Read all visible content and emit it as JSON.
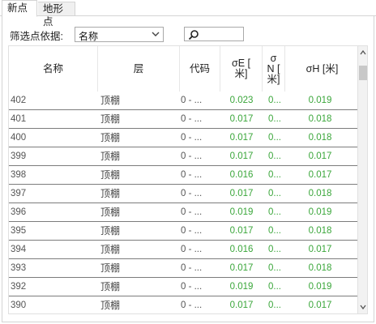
{
  "tabs": {
    "active": "新点",
    "inactive": "地形点"
  },
  "filter": {
    "label": "筛选点依据:",
    "selected": "名称",
    "search_value": ""
  },
  "table": {
    "headers": {
      "name": "名称",
      "layer": "层",
      "code": "代码",
      "sigma_e": "σE [\n米]",
      "sigma_n": "σ\nN [\n米]",
      "sigma_h": "σH [米]"
    },
    "rows": [
      {
        "name": "402",
        "layer": "顶棚",
        "code": "0 - ...",
        "sigma_e": "0.023",
        "sigma_n": "0...",
        "sigma_h": "0.019"
      },
      {
        "name": "401",
        "layer": "顶棚",
        "code": "0 - ...",
        "sigma_e": "0.017",
        "sigma_n": "0...",
        "sigma_h": "0.018"
      },
      {
        "name": "400",
        "layer": "顶棚",
        "code": "0 - ...",
        "sigma_e": "0.017",
        "sigma_n": "0...",
        "sigma_h": "0.018"
      },
      {
        "name": "399",
        "layer": "顶棚",
        "code": "0 - ...",
        "sigma_e": "0.017",
        "sigma_n": "0...",
        "sigma_h": "0.017"
      },
      {
        "name": "398",
        "layer": "顶棚",
        "code": "0 - ...",
        "sigma_e": "0.016",
        "sigma_n": "0...",
        "sigma_h": "0.017"
      },
      {
        "name": "397",
        "layer": "顶棚",
        "code": "0 - ...",
        "sigma_e": "0.017",
        "sigma_n": "0...",
        "sigma_h": "0.018"
      },
      {
        "name": "396",
        "layer": "顶棚",
        "code": "0 - ...",
        "sigma_e": "0.019",
        "sigma_n": "0...",
        "sigma_h": "0.019"
      },
      {
        "name": "395",
        "layer": "顶棚",
        "code": "0 - ...",
        "sigma_e": "0.017",
        "sigma_n": "0...",
        "sigma_h": "0.018"
      },
      {
        "name": "394",
        "layer": "顶棚",
        "code": "0 - ...",
        "sigma_e": "0.016",
        "sigma_n": "0...",
        "sigma_h": "0.017"
      },
      {
        "name": "393",
        "layer": "顶棚",
        "code": "0 - ...",
        "sigma_e": "0.017",
        "sigma_n": "0...",
        "sigma_h": "0.018"
      },
      {
        "name": "392",
        "layer": "顶棚",
        "code": "0 - ...",
        "sigma_e": "0.019",
        "sigma_n": "0...",
        "sigma_h": "0.019"
      },
      {
        "name": "390",
        "layer": "顶棚",
        "code": "0 - ...",
        "sigma_e": "0.017",
        "sigma_n": "0...",
        "sigma_h": "0.017"
      }
    ]
  },
  "colors": {
    "value_green": "#3aa63a",
    "row_divider": "#7c7c7c"
  },
  "icons": {
    "search": "search-icon",
    "dropdown": "chevron-down-icon",
    "scroll_up": "scroll-up-arrow-icon",
    "scroll_down": "scroll-down-arrow-icon"
  }
}
